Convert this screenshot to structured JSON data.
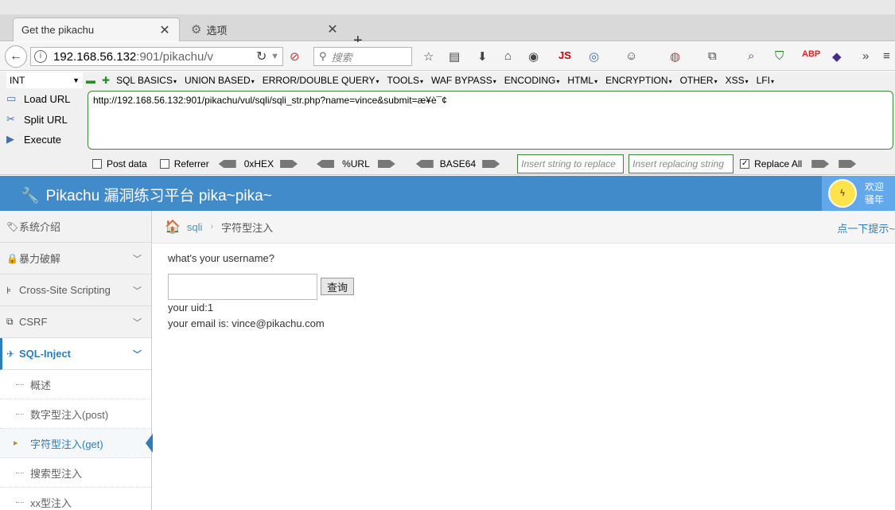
{
  "browser": {
    "tabs": [
      {
        "label": "Get the pikachu"
      },
      {
        "label": "选项"
      }
    ],
    "url_host": "192.168.56.132",
    "url_rest": ":901/pikachu/v",
    "search_placeholder": "搜索"
  },
  "hackbar": {
    "select_value": "INT",
    "menu": [
      "SQL BASICS",
      "UNION BASED",
      "ERROR/DOUBLE QUERY",
      "TOOLS",
      "WAF BYPASS",
      "ENCODING",
      "HTML",
      "ENCRYPTION",
      "OTHER",
      "XSS",
      "LFI"
    ],
    "load_url": "Load URL",
    "split_url": "Split URL",
    "execute": "Execute",
    "url_value": "http://192.168.56.132:901/pikachu/vul/sqli/sqli_str.php?name=vince&submit=æ¥è¯¢",
    "post_data": "Post data",
    "referrer": "Referrer",
    "hex": "0xHEX",
    "url_enc": "%URL",
    "base64": "BASE64",
    "replace_placeholder": "Insert string to replace",
    "replacing_placeholder": "Insert replacing string",
    "replace_all": "Replace All"
  },
  "header": {
    "title": "Pikachu 漏洞练习平台 pika~pika~",
    "welcome_line1": "欢迎",
    "welcome_line2": "骚年"
  },
  "sidebar": {
    "items": [
      {
        "label": "系统介绍"
      },
      {
        "label": "暴力破解"
      },
      {
        "label": "Cross-Site Scripting"
      },
      {
        "label": "CSRF"
      },
      {
        "label": "SQL-Inject"
      }
    ],
    "subitems": [
      {
        "label": "概述"
      },
      {
        "label": "数字型注入(post)"
      },
      {
        "label": "字符型注入(get)"
      },
      {
        "label": "搜索型注入"
      },
      {
        "label": "xx型注入"
      }
    ]
  },
  "breadcrumb": {
    "link": "sqli",
    "current": "字符型注入",
    "hint": "点一下提示~"
  },
  "main": {
    "question": "what's your username?",
    "button": "查询",
    "result_uid": "your uid:1",
    "result_email": "your email is: vince@pikachu.com"
  }
}
